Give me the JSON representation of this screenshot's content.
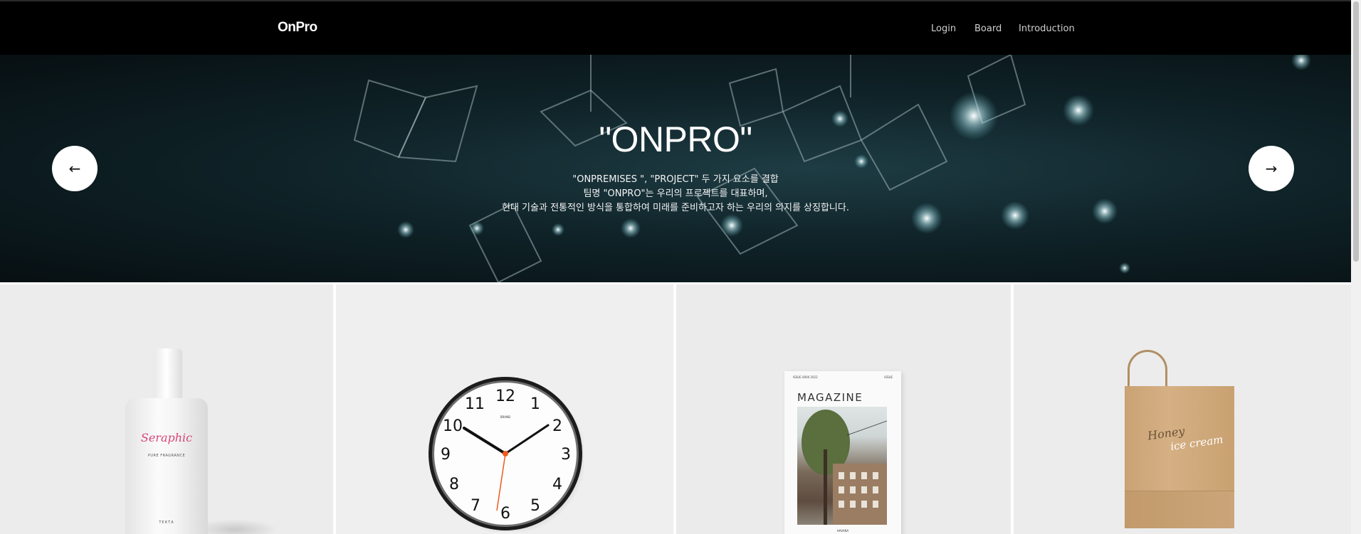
{
  "header": {
    "logo": "OnPro",
    "nav": [
      {
        "label": "Login"
      },
      {
        "label": "Board"
      },
      {
        "label": "Introduction"
      }
    ]
  },
  "hero": {
    "title": "\"ONPRO\"",
    "lines": [
      "\"ONPREMISES \", \"PROJECT\" 두 가지 요소를 결합",
      "팀명 \"ONPRO\"는 우리의 프로젝트를 대표하며,",
      "현대 기술과 전통적인 방식을 통합하여 미래를 준비하고자 하는 우리의 의지를 상징합니다."
    ],
    "prev_label": "←",
    "next_label": "→"
  },
  "products": {
    "perfume": {
      "name": "Seraphic",
      "sub": "PURE FRAGRANCE",
      "brand": "ТЕКТА"
    },
    "clock": {
      "numbers": [
        "12",
        "1",
        "2",
        "3",
        "4",
        "5",
        "6",
        "7",
        "8",
        "9",
        "10",
        "11"
      ],
      "brand": "BRAND"
    },
    "magazine": {
      "title": "MAGAZINE",
      "top_left": "ISSUE 0000 2022",
      "top_right": "ISSUE",
      "bottom": "HAVANA"
    },
    "bag": {
      "text1": "Honey",
      "text2": "ice cream"
    }
  }
}
